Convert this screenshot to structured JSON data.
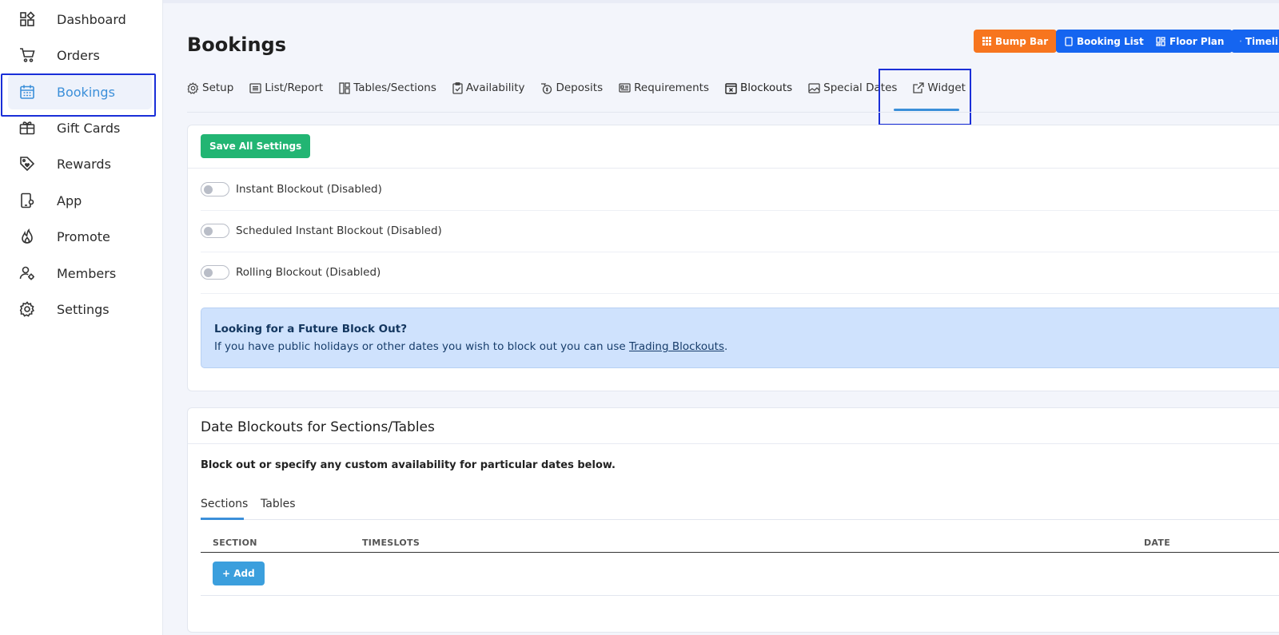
{
  "sidebar": {
    "items": [
      {
        "label": "Dashboard",
        "icon": "dashboard-icon"
      },
      {
        "label": "Orders",
        "icon": "cart-icon"
      },
      {
        "label": "Bookings",
        "icon": "calendar-icon",
        "active": true
      },
      {
        "label": "Gift Cards",
        "icon": "gift-card-icon"
      },
      {
        "label": "Rewards",
        "icon": "tag-heart-icon"
      },
      {
        "label": "App",
        "icon": "phone-gear-icon"
      },
      {
        "label": "Promote",
        "icon": "flame-icon"
      },
      {
        "label": "Members",
        "icon": "members-gear-icon"
      },
      {
        "label": "Settings",
        "icon": "gear-icon"
      }
    ]
  },
  "header": {
    "title": "Bookings",
    "buttons": {
      "bump_bar": "Bump Bar",
      "booking_list": "Booking List",
      "floor_plan": "Floor Plan",
      "timeline": "Timeli"
    }
  },
  "tabs": [
    {
      "label": "Setup",
      "icon": "gear-icon"
    },
    {
      "label": "List/Report",
      "icon": "list-icon"
    },
    {
      "label": "Tables/Sections",
      "icon": "tables-icon"
    },
    {
      "label": "Availability",
      "icon": "clipboard-check-icon"
    },
    {
      "label": "Deposits",
      "icon": "deposit-icon"
    },
    {
      "label": "Requirements",
      "icon": "id-card-icon"
    },
    {
      "label": "Blockouts",
      "icon": "calendar-x-icon",
      "active": true
    },
    {
      "label": "Special Dates",
      "icon": "image-icon"
    },
    {
      "label": "Widget",
      "icon": "external-link-icon"
    }
  ],
  "settings": {
    "save_label": "Save All Settings",
    "toggles": [
      {
        "label": "Instant Blockout (Disabled)",
        "enabled": false
      },
      {
        "label": "Scheduled Instant Blockout (Disabled)",
        "enabled": false
      },
      {
        "label": "Rolling Blockout (Disabled)",
        "enabled": false
      }
    ],
    "info": {
      "title": "Looking for a Future Block Out?",
      "text_before": "If you have public holidays or other dates you wish to block out you can use ",
      "link": "Trading Blockouts",
      "text_after": "."
    }
  },
  "date_blockouts": {
    "title": "Date Blockouts for Sections/Tables",
    "description": "Block out or specify any custom availability for particular dates below.",
    "subtabs": [
      "Sections",
      "Tables"
    ],
    "columns": [
      "SECTION",
      "TIMESLOTS",
      "DATE"
    ],
    "add_label": "+ Add"
  },
  "colors": {
    "accent": "#3b8fd9",
    "bump_bar": "#f7751e",
    "primary_blue": "#1565f0",
    "save_green": "#22b573",
    "info_bg": "#cfe2fd"
  }
}
